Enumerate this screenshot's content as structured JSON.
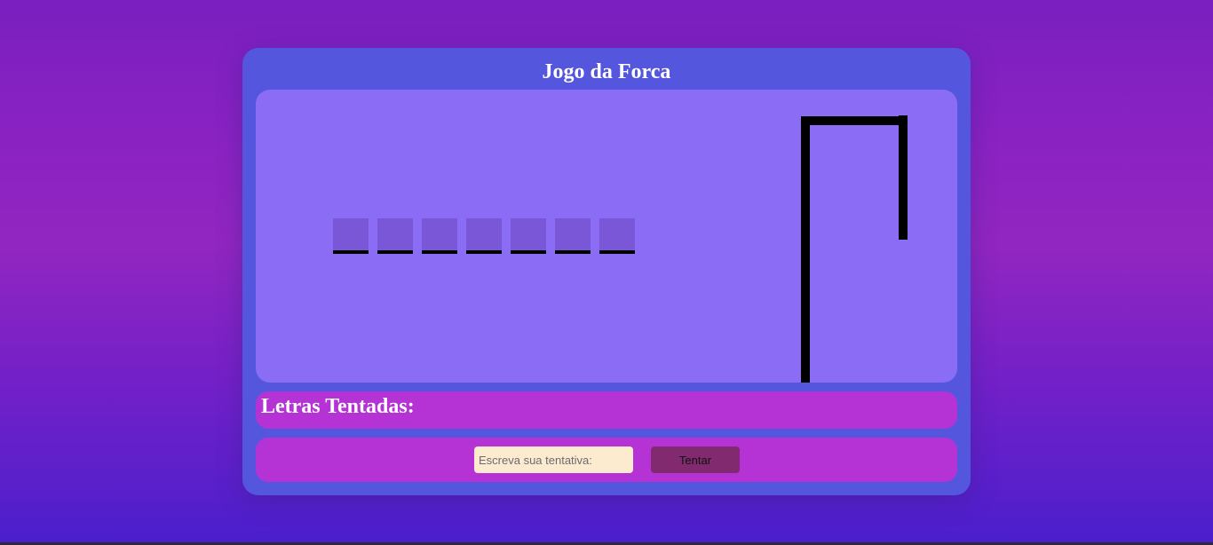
{
  "game": {
    "title": "Jogo da Forca",
    "word_slots": [
      "",
      "",
      "",
      "",
      "",
      "",
      ""
    ]
  },
  "tried_letters": {
    "label": "Letras Tentadas:",
    "letters": ""
  },
  "guess": {
    "placeholder": "Escreva sua tentativa:",
    "value": "",
    "button_label": "Tentar"
  },
  "colors": {
    "background_top": "#7a1fc0",
    "background_bottom": "#4a1fcc",
    "container": "#5457de",
    "board": "#8b6cf4",
    "letter_slot": "#7957d6",
    "panel": "#b533d4",
    "input": "#fdebcf",
    "button": "#812a6f"
  }
}
